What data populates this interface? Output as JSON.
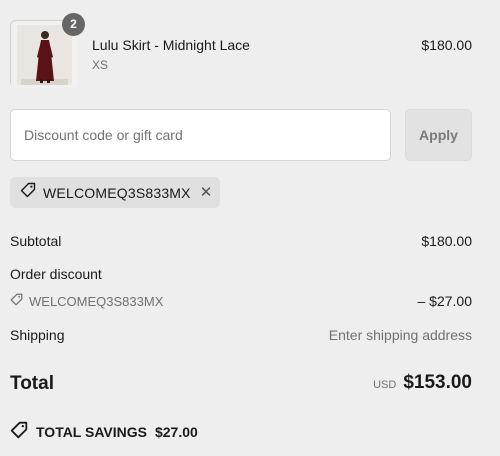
{
  "product": {
    "name": "Lulu Skirt - Midnight Lace",
    "variant": "XS",
    "price": "$180.00",
    "quantity": "2",
    "image_icon": "product-thumbnail"
  },
  "discount": {
    "placeholder": "Discount code or gift card",
    "value": "",
    "apply_label": "Apply",
    "applied_code": "WELCOMEQ3S833MX",
    "remove_icon": "✕"
  },
  "summary": {
    "subtotal_label": "Subtotal",
    "subtotal_value": "$180.00",
    "order_discount_label": "Order discount",
    "discount_code": "WELCOMEQ3S833MX",
    "discount_value": "– $27.00",
    "shipping_label": "Shipping",
    "shipping_value": "Enter shipping address",
    "total_label": "Total",
    "currency": "USD",
    "total_value": "$153.00",
    "savings_label": "TOTAL SAVINGS",
    "savings_value": "$27.00"
  },
  "colors": {
    "background": "#eeeeee",
    "badge": "#666666",
    "muted_text": "#707070"
  }
}
